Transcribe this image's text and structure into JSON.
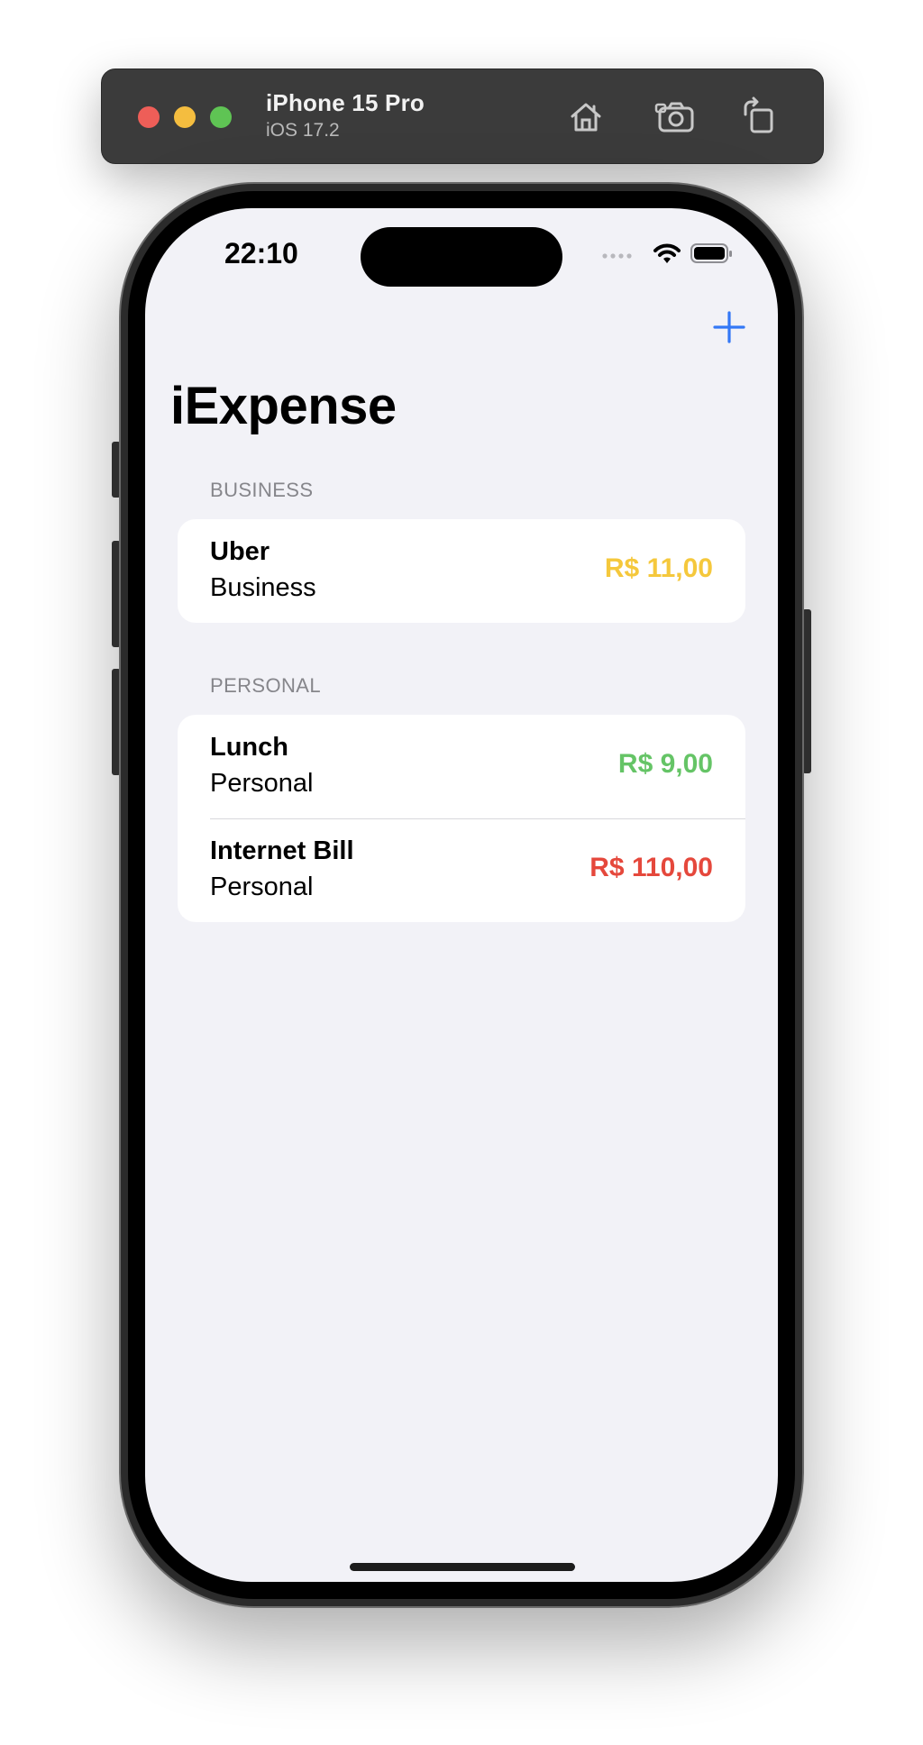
{
  "simulator": {
    "device_name": "iPhone 15 Pro",
    "os_version": "iOS 17.2",
    "buttons": {
      "home_icon": "house-icon",
      "screenshot_icon": "camera-icon",
      "rotate_icon": "rotate-icon"
    }
  },
  "status_bar": {
    "time": "22:10",
    "icons": [
      "cellular-signal-icon",
      "wifi-icon",
      "battery-icon"
    ]
  },
  "navigation": {
    "title": "iExpense",
    "add_icon": "plus-icon",
    "accent_color": "#3478f6"
  },
  "sections": [
    {
      "header": "BUSINESS",
      "items": [
        {
          "name": "Uber",
          "type": "Business",
          "amount": "R$ 11,00",
          "amount_color": "#f5c83c"
        }
      ]
    },
    {
      "header": "PERSONAL",
      "items": [
        {
          "name": "Lunch",
          "type": "Personal",
          "amount": "R$ 9,00",
          "amount_color": "#65c466"
        },
        {
          "name": "Internet Bill",
          "type": "Personal",
          "amount": "R$ 110,00",
          "amount_color": "#e5483c"
        }
      ]
    }
  ]
}
